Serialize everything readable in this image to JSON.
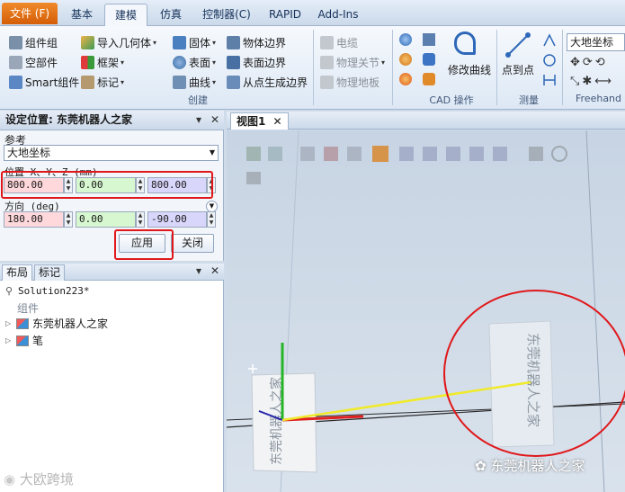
{
  "tabs": [
    "文件 (F)",
    "基本",
    "建模",
    "仿真",
    "控制器(C)",
    "RAPID",
    "Add-Ins"
  ],
  "active_tab": "建模",
  "ribbon": {
    "group_create": {
      "label": "创建",
      "items": [
        "组件组",
        "空部件",
        "Smart组件",
        "导入几何体",
        "框架",
        "标记",
        "固体",
        "表面",
        "曲线",
        "物体边界",
        "表面边界",
        "从点生成边界"
      ]
    },
    "group_cad": {
      "label": "CAD 操作",
      "items": [
        "电缆",
        "物理关节",
        "物理地板"
      ],
      "big_button": "修改曲线"
    },
    "group_measure": {
      "label": "测量",
      "big_button": "点到点"
    },
    "group_freehand": {
      "label": "Freehand",
      "combo": "大地坐标"
    }
  },
  "set_position_panel": {
    "title": "设定位置: 东莞机器人之家",
    "reference_label": "参考",
    "reference_value": "大地坐标",
    "position_label": "位置 X、Y、Z (mm)",
    "position": [
      "800.00",
      "0.00",
      "800.00"
    ],
    "orientation_label": "方向 (deg)",
    "orientation": [
      "180.00",
      "0.00",
      "-90.00"
    ],
    "apply_label": "应用",
    "close_label": "关闭"
  },
  "tree_panel": {
    "tabs": [
      "布局",
      "标记"
    ],
    "solution": "Solution223*",
    "group_label": "组件",
    "items": [
      "东莞机器人之家",
      "笔"
    ]
  },
  "viewport": {
    "tab_label": "视图1",
    "watermark_left": "大欧跨境",
    "watermark_right": "东莞机器人之家"
  },
  "colors": {
    "file_tab": "#e46f14",
    "highlight": "#e0181b",
    "x_field": "#ffd8dc",
    "y_field": "#d6f7cf",
    "z_field": "#d9d6fb"
  }
}
